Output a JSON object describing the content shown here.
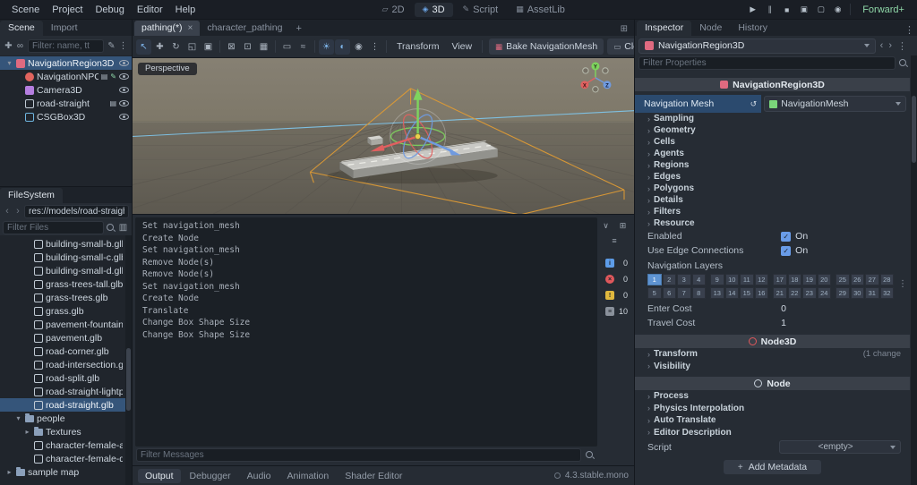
{
  "menubar": {
    "menus": [
      {
        "label": "Scene"
      },
      {
        "label": "Project"
      },
      {
        "label": "Debug"
      },
      {
        "label": "Editor"
      },
      {
        "label": "Help"
      }
    ],
    "workspaces": [
      {
        "name": "workspace-2d",
        "label": "2D",
        "glyph": "▱"
      },
      {
        "name": "workspace-3d",
        "label": "3D",
        "glyph": "◈",
        "active": true
      },
      {
        "name": "workspace-script",
        "label": "Script",
        "glyph": "✎"
      },
      {
        "name": "workspace-assetlib",
        "label": "AssetLib",
        "glyph": "▦"
      }
    ],
    "playback": [
      {
        "name": "play-button",
        "glyph": "▶"
      },
      {
        "name": "pause-button",
        "glyph": "∥"
      },
      {
        "name": "stop-button",
        "glyph": "■"
      },
      {
        "name": "play-scene-button",
        "glyph": "▣"
      },
      {
        "name": "play-custom-scene-button",
        "glyph": "▢"
      },
      {
        "name": "movie-mode-button",
        "glyph": "◉"
      }
    ],
    "renderer": "Forward+"
  },
  "scene_dock": {
    "tabs": [
      {
        "label": "Scene",
        "active": true
      },
      {
        "label": "Import"
      }
    ],
    "toolbar_icons": [
      {
        "name": "add-node-icon",
        "glyph": "✚"
      },
      {
        "name": "instantiate-scene-icon",
        "glyph": "∞"
      }
    ],
    "right_icons": [
      {
        "name": "attach-script-icon",
        "glyph": "✎"
      },
      {
        "name": "scene-more-icon",
        "glyph": "⋮"
      }
    ],
    "filter_placeholder": "Filter: name, tt",
    "tree": [
      {
        "label": "NavigationRegion3D",
        "icon": "nav",
        "depth": 0,
        "exp": "▾",
        "selected": true,
        "eye": true
      },
      {
        "label": "NavigationNPC",
        "icon": "npc",
        "depth": 1,
        "clip": true,
        "script": true,
        "eye": true
      },
      {
        "label": "Camera3D",
        "icon": "camera",
        "depth": 1,
        "eye": true
      },
      {
        "label": "road-straight",
        "icon": "mesh",
        "depth": 1,
        "clip": true,
        "eye": true
      },
      {
        "label": "CSGBox3D",
        "icon": "csg",
        "depth": 1,
        "eye": true
      }
    ]
  },
  "filesystem": {
    "tab": "FileSystem",
    "path": "res://models/road-straight.",
    "filter_placeholder": "Filter Files",
    "files": [
      {
        "label": "building-small-b.glb",
        "icon": "mesh",
        "depth": 2
      },
      {
        "label": "building-small-c.glb",
        "icon": "mesh",
        "depth": 2
      },
      {
        "label": "building-small-d.glb",
        "icon": "mesh",
        "depth": 2
      },
      {
        "label": "grass-trees-tall.glb",
        "icon": "mesh",
        "depth": 2
      },
      {
        "label": "grass-trees.glb",
        "icon": "mesh",
        "depth": 2
      },
      {
        "label": "grass.glb",
        "icon": "mesh",
        "depth": 2
      },
      {
        "label": "pavement-fountain.glb",
        "icon": "mesh",
        "depth": 2
      },
      {
        "label": "pavement.glb",
        "icon": "mesh",
        "depth": 2
      },
      {
        "label": "road-corner.glb",
        "icon": "mesh",
        "depth": 2
      },
      {
        "label": "road-intersection.glb",
        "icon": "mesh",
        "depth": 2
      },
      {
        "label": "road-split.glb",
        "icon": "mesh",
        "depth": 2
      },
      {
        "label": "road-straight-lightposts.g...",
        "icon": "mesh",
        "depth": 2
      },
      {
        "label": "road-straight.glb",
        "icon": "mesh",
        "depth": 2,
        "selected": true
      },
      {
        "label": "people",
        "icon": "folder",
        "depth": 1,
        "exp": "▾"
      },
      {
        "label": "Textures",
        "icon": "folder",
        "depth": 2,
        "exp": "▸"
      },
      {
        "label": "character-female-a.glb",
        "icon": "mesh",
        "depth": 2
      },
      {
        "label": "character-female-d.glb",
        "icon": "mesh",
        "depth": 2
      },
      {
        "label": "sample map",
        "icon": "folder",
        "depth": 0,
        "exp": "▸"
      }
    ]
  },
  "center": {
    "scene_tabs": [
      {
        "label": "pathing(*)",
        "active": true,
        "close": true
      },
      {
        "label": "character_pathing"
      }
    ],
    "toolbar_icons": [
      {
        "name": "select-tool-icon",
        "glyph": "↖",
        "active": true
      },
      {
        "name": "move-tool-icon",
        "glyph": "✚"
      },
      {
        "name": "rotate-tool-icon",
        "glyph": "↻"
      },
      {
        "name": "scale-tool-icon",
        "glyph": "◱"
      },
      {
        "name": "transform-tool-icon",
        "glyph": "▣"
      },
      {
        "type": "sep"
      },
      {
        "name": "lock-icon",
        "glyph": "⊠"
      },
      {
        "name": "unlock-icon",
        "glyph": "⊡"
      },
      {
        "name": "group-icon",
        "glyph": "▦"
      },
      {
        "type": "sep"
      },
      {
        "name": "ruler-icon",
        "glyph": "▭"
      },
      {
        "name": "snap-icon",
        "glyph": "≈"
      },
      {
        "type": "sep"
      },
      {
        "name": "sun-icon",
        "glyph": "☀",
        "active": true
      },
      {
        "name": "environment-icon",
        "glyph": "◐",
        "active": true
      },
      {
        "name": "camera-preview-icon",
        "glyph": "◉"
      },
      {
        "name": "viewport-more-icon",
        "glyph": "⋮"
      }
    ],
    "menus": [
      {
        "label": "Transform"
      },
      {
        "label": "View"
      }
    ],
    "bake_label": "Bake NavigationMesh",
    "clear_label": "Clear NavigationMesh",
    "viewport": {
      "perspective": "Perspective",
      "axis": {
        "x": "X",
        "y": "Y",
        "z": "Z"
      }
    },
    "output": {
      "lines": [
        "Set navigation_mesh",
        "Create Node",
        "Set navigation_mesh",
        "Remove Node(s)",
        "Remove Node(s)",
        "Set navigation_mesh",
        "Create Node",
        "Translate",
        "Change Box Shape Size",
        "Change Box Shape Size"
      ],
      "side_icons": [
        {
          "name": "expand-output-icon",
          "glyph": "∨"
        },
        {
          "name": "copy-log-icon",
          "glyph": "⊞"
        }
      ],
      "list_icon": {
        "name": "filter-list-icon",
        "glyph": "≡"
      },
      "counters": [
        {
          "type": "info",
          "count": "0"
        },
        {
          "type": "error",
          "count": "0"
        },
        {
          "type": "warning",
          "count": "0"
        },
        {
          "type": "message",
          "count": "10"
        }
      ],
      "filter_placeholder": "Filter Messages"
    },
    "bottom_tabs": [
      {
        "label": "Output",
        "active": true
      },
      {
        "label": "Debugger"
      },
      {
        "label": "Audio"
      },
      {
        "label": "Animation"
      },
      {
        "label": "Shader Editor"
      }
    ],
    "version": "4.3.stable.mono"
  },
  "inspector": {
    "tabs": [
      {
        "label": "Inspector",
        "active": true
      },
      {
        "label": "Node"
      },
      {
        "label": "History"
      }
    ],
    "object_name": "NavigationRegion3D",
    "filter_placeholder": "Filter Properties",
    "category": "NavigationRegion3D",
    "navigation_mesh": {
      "label": "Navigation Mesh",
      "value": "NavigationMesh"
    },
    "subsections": [
      "Sampling",
      "Geometry",
      "Cells",
      "Agents",
      "Regions",
      "Edges",
      "Polygons",
      "Details",
      "Filters",
      "Resource"
    ],
    "toggles": [
      {
        "label": "Enabled",
        "value": "On"
      },
      {
        "label": "Use Edge Connections",
        "value": "On"
      }
    ],
    "nav_layers": {
      "label": "Navigation Layers",
      "rows": [
        [
          1,
          2,
          3,
          4,
          9,
          10,
          11,
          12,
          17,
          18,
          19,
          20,
          25,
          26,
          27,
          28
        ],
        [
          5,
          6,
          7,
          8,
          13,
          14,
          15,
          16,
          21,
          22,
          23,
          24,
          29,
          30,
          31,
          32
        ]
      ],
      "active": [
        1
      ]
    },
    "costs": [
      {
        "label": "Enter Cost",
        "value": "0"
      },
      {
        "label": "Travel Cost",
        "value": "1"
      }
    ],
    "sections": [
      {
        "header": "Node3D",
        "rows": [
          {
            "label": "Transform",
            "note": "(1 change"
          },
          {
            "label": "Visibility",
            "note": ""
          }
        ]
      },
      {
        "header": "Node",
        "rows": [
          {
            "label": "Process",
            "note": ""
          },
          {
            "label": "Physics Interpolation",
            "note": ""
          },
          {
            "label": "Auto Translate",
            "note": ""
          },
          {
            "label": "Editor Description",
            "note": ""
          }
        ]
      }
    ],
    "script_row": {
      "label": "Script",
      "value": "<empty>"
    },
    "add_metadata_label": "Add Metadata"
  }
}
